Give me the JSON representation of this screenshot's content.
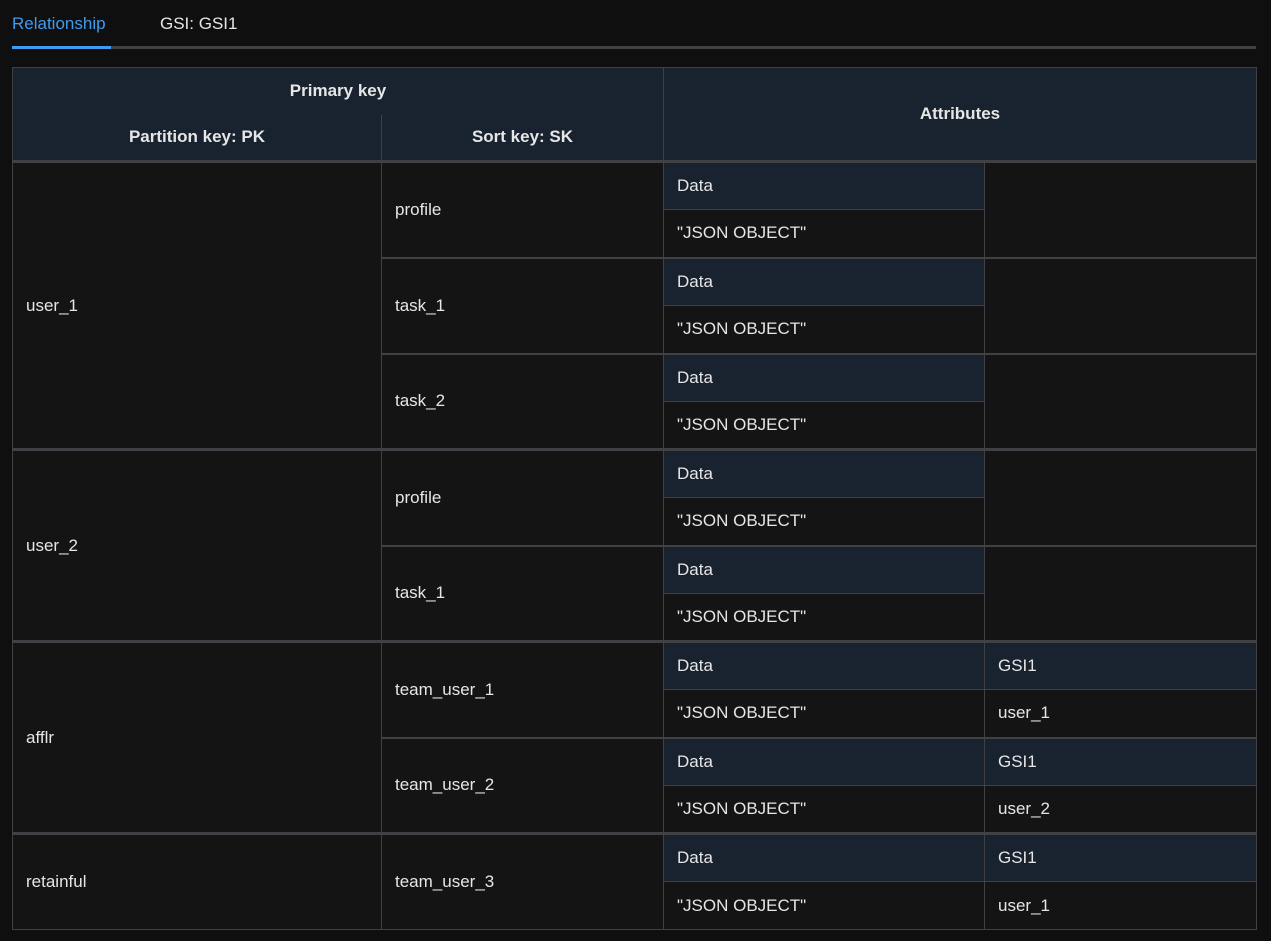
{
  "tabs": [
    {
      "label": "Relationship",
      "active": true
    },
    {
      "label": "GSI: GSI1",
      "active": false
    }
  ],
  "header": {
    "primary_key": "Primary key",
    "partition_key": "Partition key: PK",
    "sort_key": "Sort key: SK",
    "attributes": "Attributes"
  },
  "rows": [
    {
      "pk": "user_1",
      "sk": "profile",
      "attr_name_1": "Data",
      "attr_val_1": "\"JSON OBJECT\""
    },
    {
      "sk": "task_1",
      "attr_name_1": "Data",
      "attr_val_1": "\"JSON OBJECT\""
    },
    {
      "sk": "task_2",
      "attr_name_1": "Data",
      "attr_val_1": "\"JSON OBJECT\""
    },
    {
      "pk": "user_2",
      "sk": "profile",
      "attr_name_1": "Data",
      "attr_val_1": "\"JSON OBJECT\""
    },
    {
      "sk": "task_1",
      "attr_name_1": "Data",
      "attr_val_1": "\"JSON OBJECT\""
    },
    {
      "pk": "afflr",
      "sk": "team_user_1",
      "attr_name_1": "Data",
      "attr_val_1": "\"JSON OBJECT\"",
      "attr_name_2": "GSI1",
      "attr_val_2": "user_1"
    },
    {
      "sk": "team_user_2",
      "attr_name_1": "Data",
      "attr_val_1": "\"JSON OBJECT\"",
      "attr_name_2": "GSI1",
      "attr_val_2": "user_2"
    },
    {
      "pk": "retainful",
      "sk": "team_user_3",
      "attr_name_1": "Data",
      "attr_val_1": "\"JSON OBJECT\"",
      "attr_name_2": "GSI1",
      "attr_val_2": "user_1"
    }
  ],
  "colors": {
    "accent": "#3d9cf0",
    "header_bg": "#192330",
    "cell_bg": "#141414",
    "border": "#3f4144"
  }
}
